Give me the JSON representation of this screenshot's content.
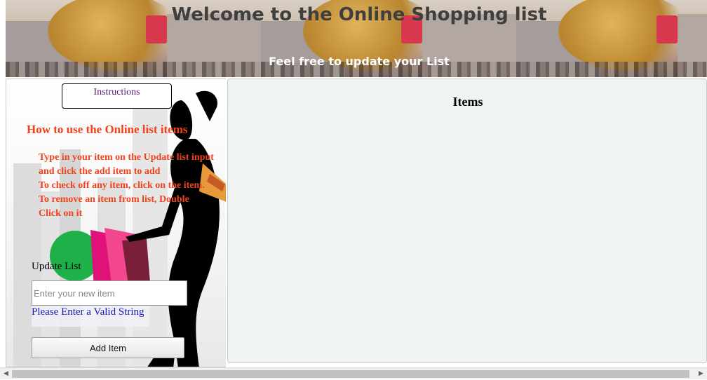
{
  "banner": {
    "title": "Welcome to the Online Shopping list",
    "subtitle": "Feel free to update your List"
  },
  "sidebar": {
    "instructions_label": "Instructions",
    "howto_heading": "How to use the Online list items",
    "howto_lines": [
      "Type in your item on the Update list input and click the add item to add",
      "To check off any item, click on the item.",
      "To remove an item from list, Double Click on it"
    ],
    "update_label": "Update List",
    "input": {
      "value": "",
      "placeholder": "Enter your new item"
    },
    "validation_message": "Please Enter a Valid String",
    "add_button_label": "Add Item"
  },
  "main": {
    "items_heading": "Items",
    "items": []
  },
  "scrollbar": {
    "left_arrow_icon": "scroll-left-arrow-icon",
    "right_arrow_icon": "scroll-right-arrow-icon"
  },
  "colors": {
    "instruction_text": "#f2421b",
    "validation_text": "#1a1ab8",
    "instructions_button_text": "#5b1a73",
    "items_panel_bg": "#eff3f3"
  }
}
